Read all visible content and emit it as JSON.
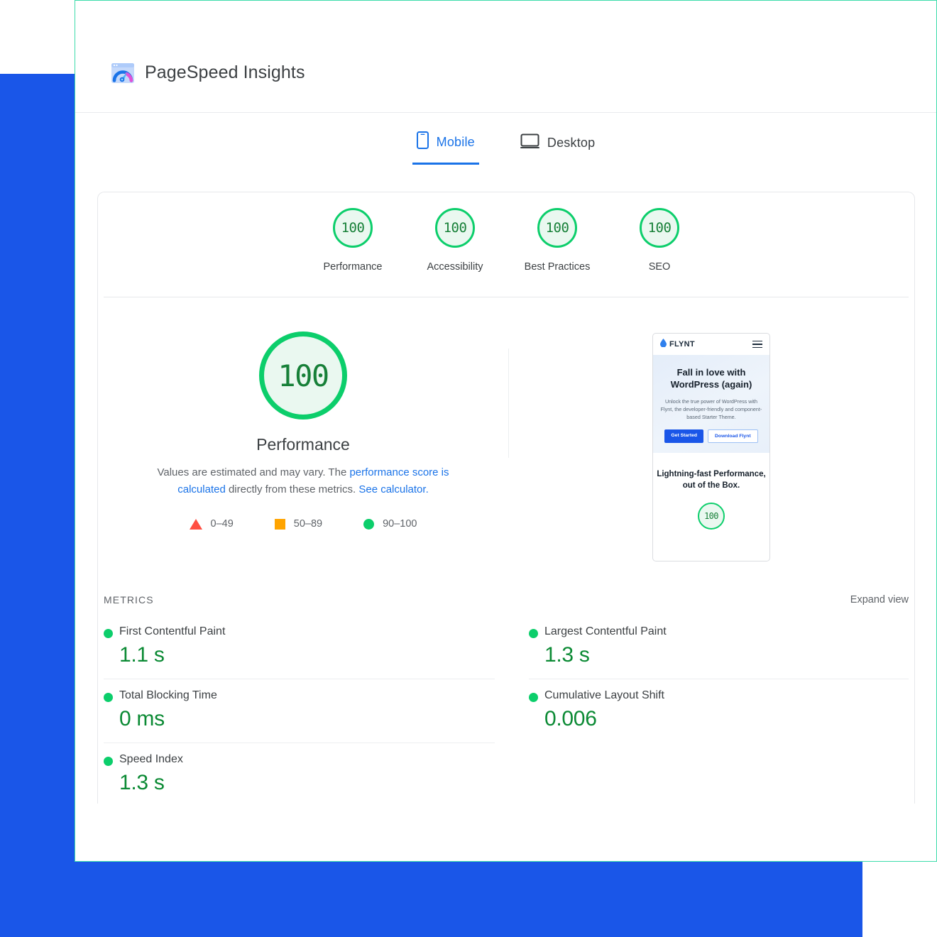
{
  "theme": {
    "accent_blue": "#1a73e8",
    "brand_blue_block": "#1a56e8",
    "teal_border": "#3ddcab",
    "pass_green": "#0cce6b",
    "score_text_green": "#178038",
    "metric_value_green": "#0b8a34",
    "average_orange": "#ffa400",
    "fail_red": "#ff4e42",
    "text_primary": "#3c4043",
    "text_secondary": "#5f6368"
  },
  "header": {
    "title": "PageSpeed Insights",
    "logo_icon": "pagespeed-gauge-icon"
  },
  "tabs": [
    {
      "id": "mobile",
      "label": "Mobile",
      "icon": "mobile-phone-icon",
      "active": true
    },
    {
      "id": "desktop",
      "label": "Desktop",
      "icon": "desktop-monitor-icon",
      "active": false
    }
  ],
  "categories": [
    {
      "label": "Performance",
      "score": "100"
    },
    {
      "label": "Accessibility",
      "score": "100"
    },
    {
      "label": "Best Practices",
      "score": "100"
    },
    {
      "label": "SEO",
      "score": "100"
    }
  ],
  "performance_detail": {
    "score": "100",
    "title": "Performance",
    "description_prefix": "Values are estimated and may vary. The ",
    "description_link1": "performance score is calculated",
    "description_middle": " directly from these metrics. ",
    "description_link2": "See calculator."
  },
  "legend": [
    {
      "shape": "triangle",
      "range": "0–49",
      "color": "#ff4e42"
    },
    {
      "shape": "square",
      "range": "50–89",
      "color": "#ffa400"
    },
    {
      "shape": "circle",
      "range": "90–100",
      "color": "#0cce6b"
    }
  ],
  "thumbnail": {
    "brand": "FLYNT",
    "brand_icon": "water-drop-icon",
    "menu_icon": "hamburger-menu-icon",
    "hero_heading": "Fall in love with WordPress (again)",
    "hero_paragraph": "Unlock the true power of WordPress with Flynt, the developer-friendly and component-based Starter Theme.",
    "primary_button": "Get Started",
    "secondary_button": "Download Flynt",
    "lower_heading": "Lightning-fast Performance, out of the Box.",
    "lower_score": "100"
  },
  "metrics_section": {
    "title": "METRICS",
    "expand_label": "Expand view",
    "left_column": [
      {
        "name": "First Contentful Paint",
        "value": "1.1 s",
        "status": "pass"
      },
      {
        "name": "Total Blocking Time",
        "value": "0 ms",
        "status": "pass"
      },
      {
        "name": "Speed Index",
        "value": "1.3 s",
        "status": "pass"
      }
    ],
    "right_column": [
      {
        "name": "Largest Contentful Paint",
        "value": "1.3 s",
        "status": "pass"
      },
      {
        "name": "Cumulative Layout Shift",
        "value": "0.006",
        "status": "pass"
      }
    ]
  }
}
